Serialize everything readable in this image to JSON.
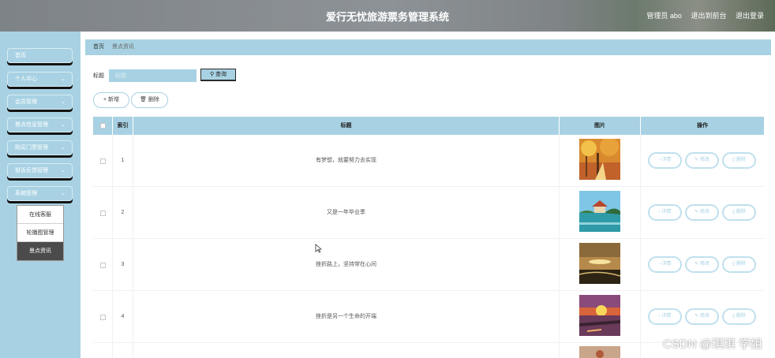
{
  "header": {
    "title": "爱行无忧旅游票务管理系统",
    "user": "管理员 abo",
    "back_to_front": "退出到前台",
    "logout": "退出登录"
  },
  "sidebar": {
    "items": [
      {
        "label": "首页",
        "chevron": false
      },
      {
        "label": "个人中心",
        "chevron": true
      },
      {
        "label": "会员管理",
        "chevron": true
      },
      {
        "label": "景点信息管理",
        "chevron": true
      },
      {
        "label": "购买门票管理",
        "chevron": true
      },
      {
        "label": "投诉反馈管理",
        "chevron": true
      },
      {
        "label": "系统管理",
        "chevron": true
      }
    ],
    "submenu": [
      "在线客服",
      "轮播图管理",
      "景点资讯"
    ],
    "active_sub": "景点资讯"
  },
  "breadcrumb": {
    "home": "首页",
    "current": "景点资讯"
  },
  "search": {
    "label": "标题",
    "placeholder": "标题",
    "button": "查询"
  },
  "actions": {
    "add": "新增",
    "delete": "删除"
  },
  "table": {
    "headers": {
      "index": "索引",
      "title": "标题",
      "image": "图片",
      "ops": "操作"
    },
    "rows": [
      {
        "index": "1",
        "title": "有梦想，就要努力去实现"
      },
      {
        "index": "2",
        "title": "又是一年毕业季"
      },
      {
        "index": "3",
        "title": "挫折路上，坚持常在心间"
      },
      {
        "index": "4",
        "title": "挫折是另一个生命的开端"
      }
    ],
    "ops": {
      "detail": "详情",
      "edit": "修改",
      "delete": "删除"
    }
  },
  "watermark": "CSDN @琪琪 学姐"
}
